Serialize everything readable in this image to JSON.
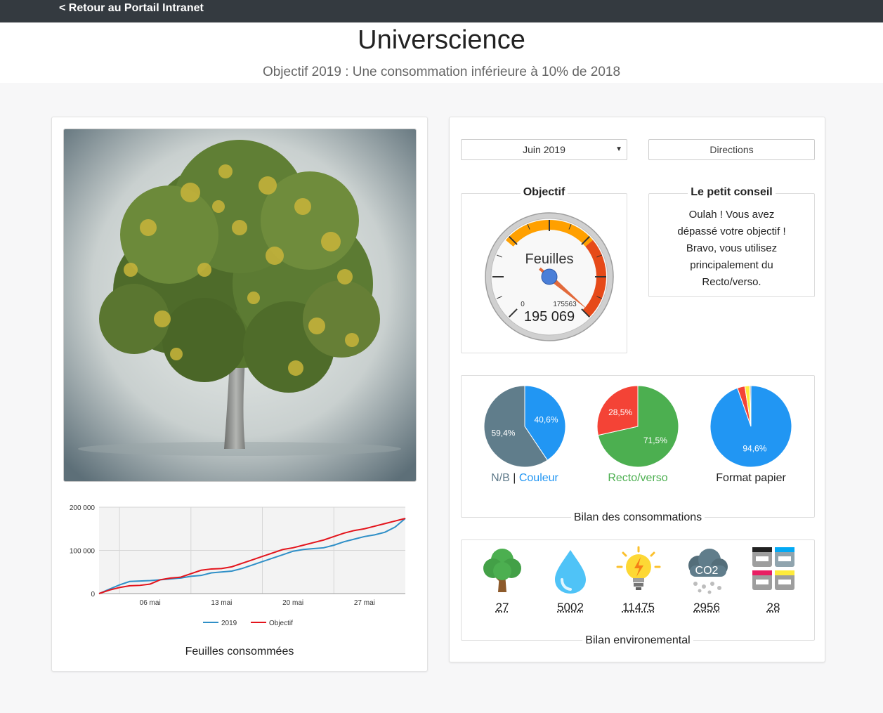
{
  "topbar": {
    "back_label": "< Retour au Portail Intranet"
  },
  "header": {
    "title": "Universcience",
    "subtitle": "Objectif 2019 : Une consommation inférieure à 10% de 2018"
  },
  "left_panel": {
    "caption": "Feuilles consommées"
  },
  "chart_data": {
    "type": "line",
    "title": "",
    "xlabel": "",
    "ylabel": "",
    "x_ticks": [
      "06 mai",
      "13 mai",
      "20 mai",
      "27 mai"
    ],
    "y_ticks": [
      "0",
      "100 000",
      "200 000"
    ],
    "ylim": [
      0,
      200000
    ],
    "x": [
      1,
      2,
      3,
      4,
      5,
      6,
      7,
      8,
      9,
      10,
      11,
      12,
      13,
      14,
      15,
      16,
      17,
      18,
      19,
      20,
      21,
      22,
      23,
      24,
      25,
      26,
      27,
      28,
      29,
      30,
      31
    ],
    "legend_position": "bottom",
    "series": [
      {
        "name": "2019",
        "color": "#2f8fc7",
        "values": [
          0,
          10000,
          20000,
          28000,
          29000,
          30000,
          32000,
          34000,
          36000,
          40000,
          42000,
          48000,
          50000,
          52000,
          58000,
          66000,
          74000,
          82000,
          90000,
          98000,
          102000,
          104000,
          106000,
          112000,
          120000,
          126000,
          132000,
          136000,
          142000,
          154000,
          174000
        ]
      },
      {
        "name": "Objectif",
        "color": "#e3141c",
        "values": [
          0,
          8000,
          14000,
          18000,
          19000,
          22000,
          32000,
          36000,
          38000,
          46000,
          54000,
          57000,
          58000,
          62000,
          70000,
          78000,
          86000,
          94000,
          102000,
          106000,
          112000,
          118000,
          124000,
          132000,
          140000,
          146000,
          150000,
          156000,
          162000,
          168000,
          174000
        ]
      }
    ]
  },
  "controls": {
    "month_select": "Juin 2019",
    "directions_label": "Directions"
  },
  "objectif": {
    "legend": "Objectif",
    "gauge_label": "Feuilles",
    "min_label": "0",
    "max_label": "175563",
    "value_label": "195 069",
    "value": 195069,
    "max": 175563
  },
  "conseil": {
    "legend": "Le petit conseil",
    "lines": [
      "Oulah ! Vous avez",
      "dépassé votre objectif !",
      "Bravo, vous utilisez",
      "principalement du",
      "Recto/verso."
    ]
  },
  "bilan": {
    "legend": "Bilan des consommations",
    "pies": [
      {
        "label_a": "N/B",
        "label_sep": " | ",
        "label_b": "Couleur",
        "label_a_color": "#5f7a8a",
        "label_b_color": "#2196f3",
        "slices": [
          {
            "value": 40.6,
            "label": "40,6%",
            "color": "#2196f3"
          },
          {
            "value": 59.4,
            "label": "59,4%",
            "color": "#607d8b"
          }
        ]
      },
      {
        "label": "Recto/verso",
        "label_color": "#4caf50",
        "slices": [
          {
            "value": 71.5,
            "label": "71,5%",
            "color": "#4caf50"
          },
          {
            "value": 28.5,
            "label": "28,5%",
            "color": "#f44336"
          }
        ]
      },
      {
        "label": "Format papier",
        "label_color": "#222",
        "slices": [
          {
            "value": 94.6,
            "label": "94,6%",
            "color": "#2196f3"
          },
          {
            "value": 3.0,
            "label": "",
            "color": "#f44336"
          },
          {
            "value": 1.9,
            "label": "",
            "color": "#ffeb3b"
          },
          {
            "value": 0.5,
            "label": "",
            "color": "#9e9e9e"
          }
        ]
      }
    ]
  },
  "environment": {
    "legend": "Bilan environemental",
    "items": [
      {
        "icon": "tree-icon",
        "value": "27"
      },
      {
        "icon": "water-drop-icon",
        "value": "5002"
      },
      {
        "icon": "light-bulb-icon",
        "value": "11475"
      },
      {
        "icon": "co2-cloud-icon",
        "value": "2956"
      },
      {
        "icon": "cartridges-icon",
        "value": "28"
      }
    ],
    "co2_text": "CO2"
  }
}
